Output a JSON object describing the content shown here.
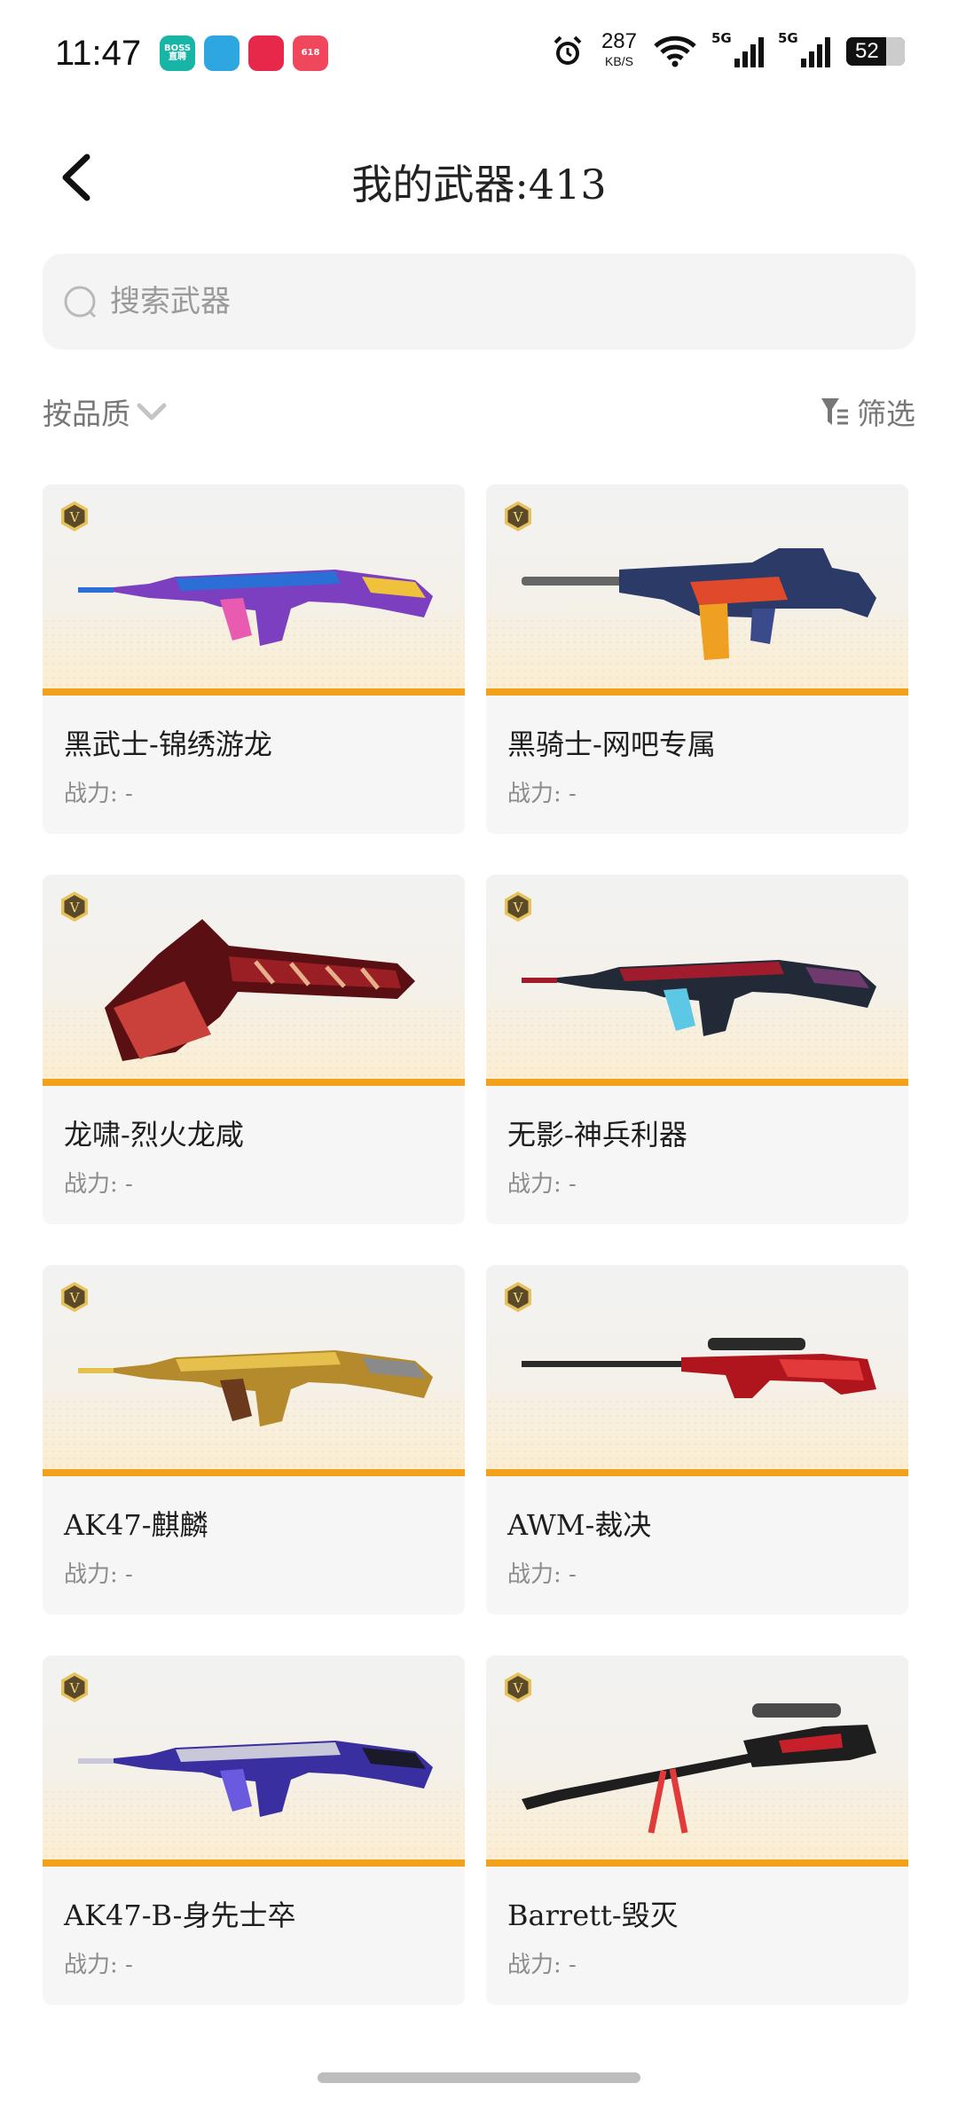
{
  "status_bar": {
    "time": "11:47",
    "apps": [
      {
        "name": "boss-app-icon",
        "label": "BOSS直聘",
        "color": "#17b5a6"
      },
      {
        "name": "telegram-app-icon",
        "label": "",
        "color": "#2ea6e0"
      },
      {
        "name": "pinduoduo-app-icon",
        "label": "",
        "color": "#e8284b"
      },
      {
        "name": "tmall-618-app-icon",
        "label": "618",
        "color": "#f1475d"
      }
    ],
    "net_speed_value": "287",
    "net_speed_unit": "KB/S",
    "signal_1_tag": "5G",
    "signal_2_tag": "5G",
    "battery": "52"
  },
  "header": {
    "title": "我的武器:413",
    "back_icon": "chevron-left-icon"
  },
  "search": {
    "placeholder": "搜索武器",
    "value": ""
  },
  "toolbar": {
    "sort_label": "按品质",
    "filter_label": "筛选"
  },
  "weapons": [
    {
      "name": "黑武士-锦绣游龙",
      "power": "战力: -",
      "kind": "rifle-ak",
      "palette": [
        "#7b3fbf",
        "#2b6fd6",
        "#e85bb0",
        "#f0c23c"
      ]
    },
    {
      "name": "黑骑士-网吧专属",
      "power": "战力: -",
      "kind": "rifle-m4",
      "palette": [
        "#2b3a66",
        "#e04a2a",
        "#f0a020",
        "#3a4a8a"
      ]
    },
    {
      "name": "龙啸-烈火龙咸",
      "power": "战力: -",
      "kind": "axe",
      "palette": [
        "#9a1f24",
        "#c9413a",
        "#e6b08a",
        "#5a0f12"
      ]
    },
    {
      "name": "无影-神兵利器",
      "power": "战力: -",
      "kind": "rifle-ak",
      "palette": [
        "#222a38",
        "#a01c2c",
        "#5dc8e6",
        "#6e3a6e"
      ]
    },
    {
      "name": "AK47-麒麟",
      "power": "战力: -",
      "kind": "rifle-ak",
      "palette": [
        "#b48a2c",
        "#e6c04c",
        "#6b3a1c",
        "#8a8a8a"
      ]
    },
    {
      "name": "AWM-裁决",
      "power": "战力: -",
      "kind": "sniper",
      "palette": [
        "#b0141c",
        "#2a2a2a",
        "#e23a3a",
        "#5a0a0e"
      ]
    },
    {
      "name": "AK47-B-身先士卒",
      "power": "战力: -",
      "kind": "rifle-ak",
      "palette": [
        "#3a2fa0",
        "#c8c8d8",
        "#6a5ae0",
        "#1a1a2a"
      ]
    },
    {
      "name": "Barrett-毁灭",
      "power": "战力: -",
      "kind": "barrett",
      "palette": [
        "#1e1e1e",
        "#c8202a",
        "#4a4a4a",
        "#e03a3a"
      ]
    }
  ],
  "badge_label": "V"
}
